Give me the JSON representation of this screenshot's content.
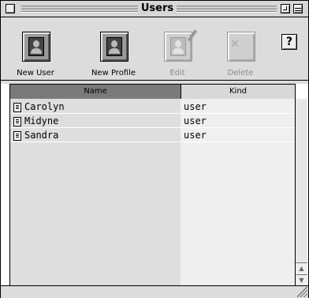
{
  "window": {
    "title": "Users"
  },
  "toolbar": {
    "new_user_label": "New User",
    "new_profile_label": "New Profile",
    "edit_label": "Edit",
    "delete_label": "Delete",
    "help_label": "?"
  },
  "table": {
    "columns": {
      "name": "Name",
      "kind": "Kind"
    },
    "rows": [
      {
        "name": "Carolyn",
        "kind": "user"
      },
      {
        "name": "Midyne",
        "kind": "user"
      },
      {
        "name": "Sandra",
        "kind": "user"
      }
    ]
  }
}
